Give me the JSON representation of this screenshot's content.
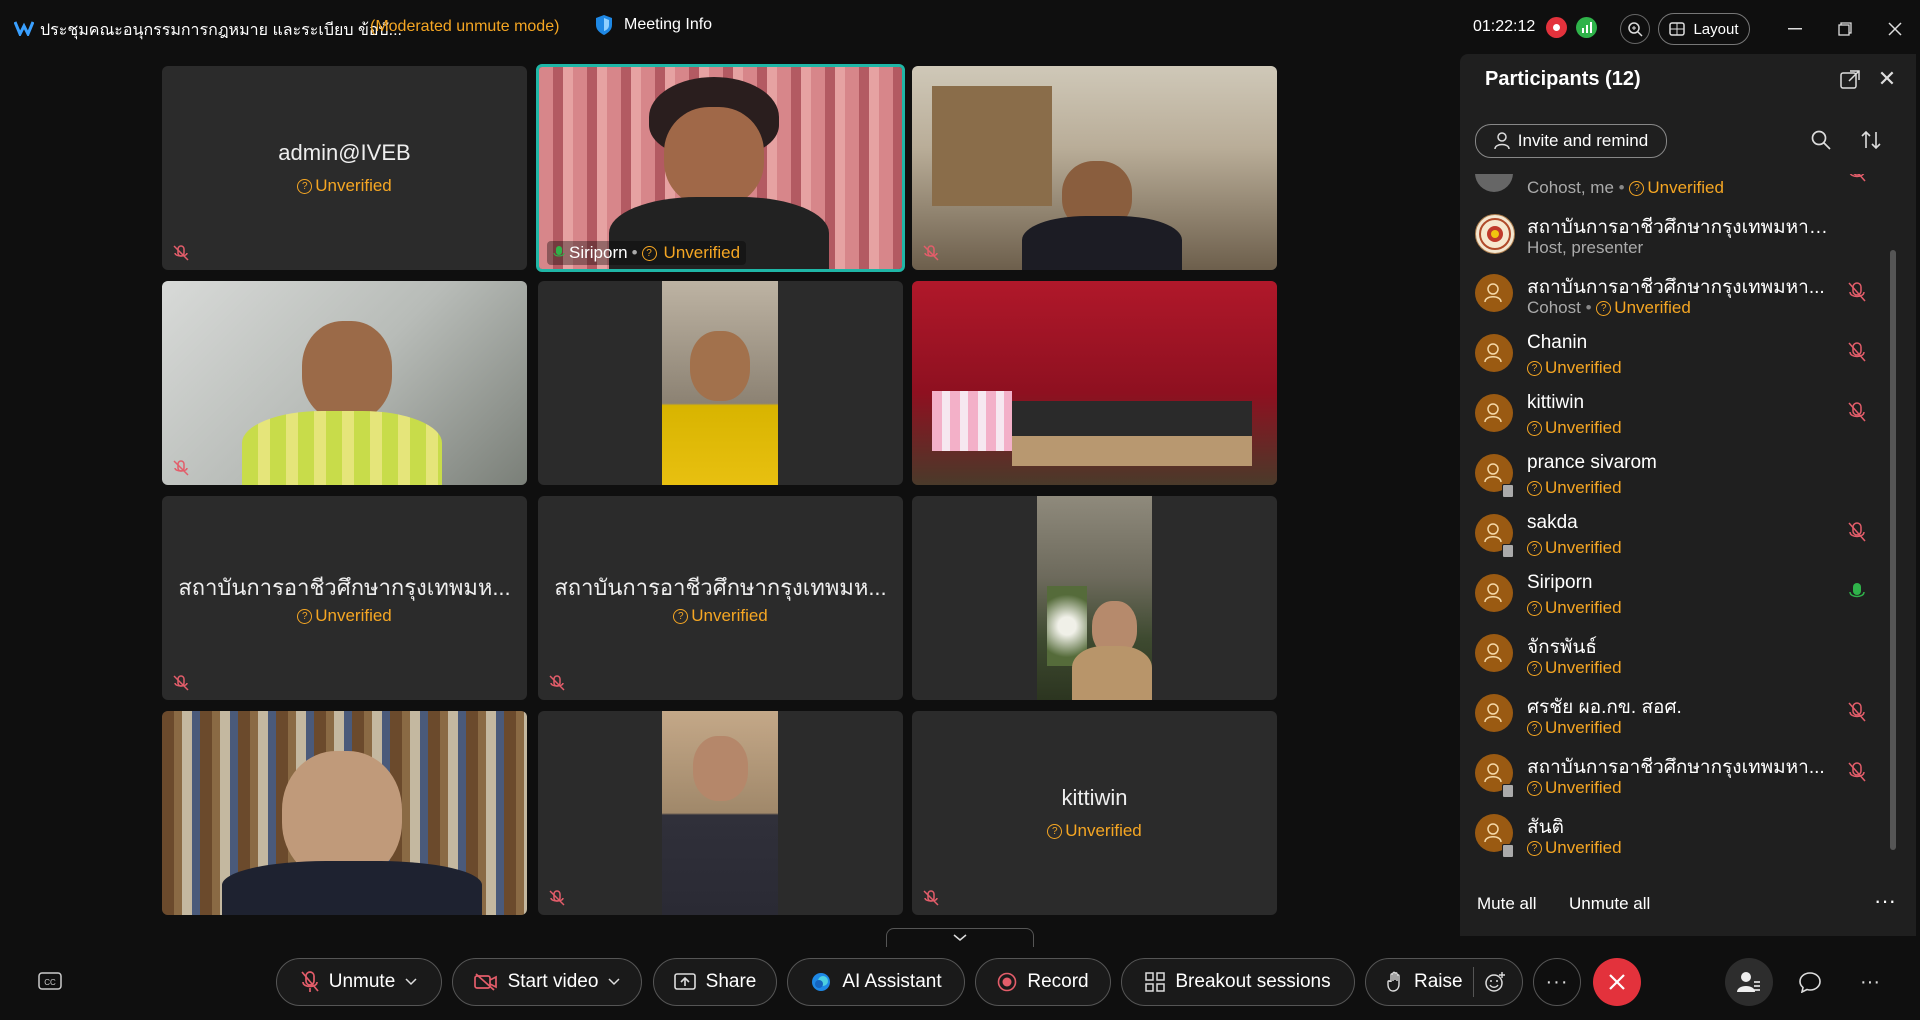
{
  "titlebar": {
    "meeting_title": "ประชุมคณะอนุกรรมการกฎหมาย และระเบียบ ข้อบั...",
    "mode": "(Moderated unmute mode)",
    "meeting_info": "Meeting Info",
    "timer": "01:22:12",
    "layout": "Layout"
  },
  "grid": {
    "tile1": {
      "name": "admin@IVEB",
      "status": "Unverified"
    },
    "tile2": {
      "name": "Siriporn",
      "status": "Unverified"
    },
    "tile7": {
      "name": "สถาบันการอาชีวศึกษากรุงเทพมห...",
      "status": "Unverified"
    },
    "tile8": {
      "name": "สถาบันการอาชีวศึกษากรุงเทพมห...",
      "status": "Unverified"
    },
    "tile12": {
      "name": "kittiwin",
      "status": "Unverified"
    }
  },
  "panel": {
    "title": "Participants (12)",
    "invite": "Invite and remind",
    "mute_all": "Mute all",
    "unmute_all": "Unmute all",
    "participants": [
      {
        "name": "",
        "role": "Cohost, me",
        "status": "Unverified"
      },
      {
        "name": "สถาบันการอาชีวศึกษากรุงเทพมหานคร",
        "role": "Host, presenter",
        "status": ""
      },
      {
        "name": "สถาบันการอาชีวศึกษากรุงเทพมหา...",
        "role": "Cohost",
        "status": "Unverified"
      },
      {
        "name": "Chanin",
        "role": "",
        "status": "Unverified"
      },
      {
        "name": "kittiwin",
        "role": "",
        "status": "Unverified"
      },
      {
        "name": "prance sivarom",
        "role": "",
        "status": "Unverified"
      },
      {
        "name": "sakda",
        "role": "",
        "status": "Unverified"
      },
      {
        "name": "Siriporn",
        "role": "",
        "status": "Unverified"
      },
      {
        "name": "จักรพันธ์",
        "role": "",
        "status": "Unverified"
      },
      {
        "name": "ศรชัย ผอ.กข. สอศ.",
        "role": "",
        "status": "Unverified"
      },
      {
        "name": "สถาบันการอาชีวศึกษากรุงเทพมหา...",
        "role": "",
        "status": "Unverified"
      },
      {
        "name": "สันติ",
        "role": "",
        "status": "Unverified"
      }
    ]
  },
  "toolbar": {
    "unmute": "Unmute",
    "start_video": "Start video",
    "share": "Share",
    "ai_assistant": "AI Assistant",
    "record": "Record",
    "breakout": "Breakout sessions",
    "raise": "Raise"
  },
  "colors": {
    "accent": "#1fb6a6",
    "warning": "#f5a623",
    "danger": "#e3323c",
    "mic_active": "#2fb34a"
  }
}
